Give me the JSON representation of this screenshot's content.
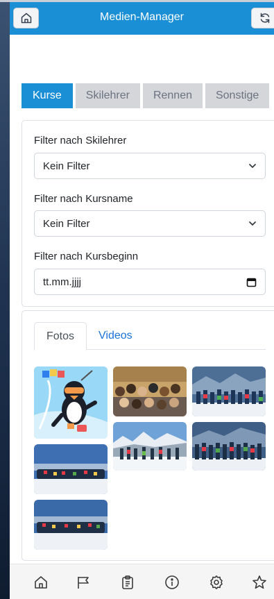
{
  "header": {
    "title": "Medien-Manager",
    "home_icon": "home-icon",
    "reload_icon": "refresh-icon"
  },
  "category_tabs": [
    {
      "label": "Kurse",
      "active": true
    },
    {
      "label": "Skilehrer",
      "active": false
    },
    {
      "label": "Rennen",
      "active": false
    },
    {
      "label": "Sonstige",
      "active": false
    }
  ],
  "filters": {
    "instructor": {
      "label": "Filter nach Skilehrer",
      "value": "Kein Filter"
    },
    "course_name": {
      "label": "Filter nach Kursname",
      "value": "Kein Filter"
    },
    "course_start": {
      "label": "Filter nach Kursbeginn",
      "value": "tt.mm.jjjj"
    }
  },
  "media_tabs": [
    {
      "label": "Fotos",
      "active": true
    },
    {
      "label": "Videos",
      "active": false
    }
  ],
  "photos": [
    {
      "kind": "mascot"
    },
    {
      "kind": "group-indoor"
    },
    {
      "kind": "group-snow"
    },
    {
      "kind": "group-mountains"
    },
    {
      "kind": "group-snow"
    },
    {
      "kind": "group-sky"
    },
    {
      "kind": "group-sky"
    }
  ],
  "bottom_nav": [
    "home-icon",
    "flag-icon",
    "clipboard-icon",
    "info-icon",
    "settings-icon",
    "star-icon"
  ],
  "colors": {
    "accent": "#1a8fd6",
    "tab_inactive": "#d4d6d9",
    "link": "#1a73d9"
  }
}
